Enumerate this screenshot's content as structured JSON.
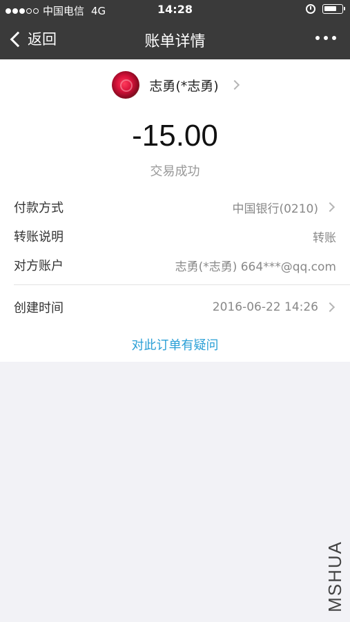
{
  "status_bar": {
    "signal": "●●●○○",
    "carrier": "中国电信",
    "network": "4G",
    "time": "14:28",
    "battery_level": 0.75
  },
  "nav": {
    "back_label": "返回",
    "title": "账单详情",
    "more_icon": "more-dots-icon"
  },
  "payee": {
    "name": "志勇(*志勇)"
  },
  "transaction": {
    "amount": "-15.00",
    "status": "交易成功"
  },
  "details": [
    {
      "label": "付款方式",
      "value": "中国银行(0210)"
    },
    {
      "label": "转账说明",
      "value": "转账"
    },
    {
      "label": "对方账户",
      "value": "志勇(*志勇) 664***@qq.com"
    },
    {
      "label": "创建时间",
      "value": "2016-06-22 14:26"
    }
  ],
  "dispute_link": "对此订单有疑问",
  "watermark": "MSHUA"
}
